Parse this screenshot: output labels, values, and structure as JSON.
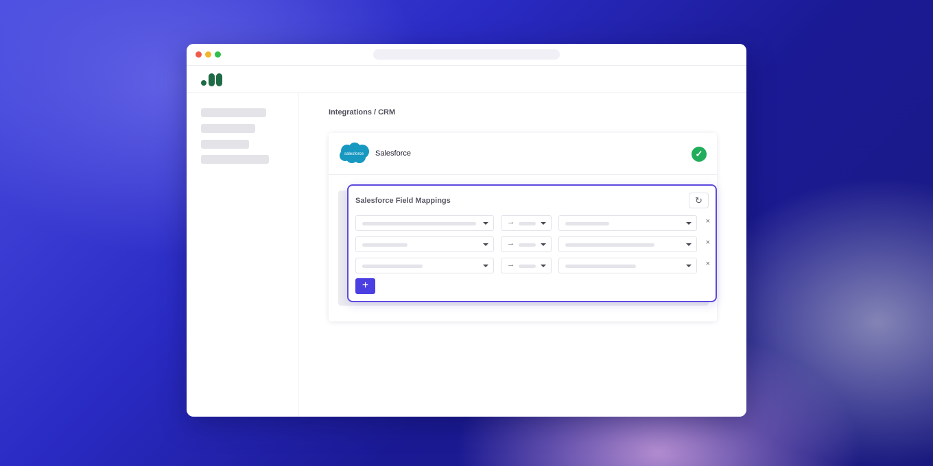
{
  "window": {
    "controls": [
      "close",
      "minimize",
      "maximize"
    ]
  },
  "app": {
    "logo_icon": "brand-bars-logo"
  },
  "main": {
    "breadcrumb": "Integrations / CRM",
    "integration": {
      "name": "Salesforce",
      "logo_text": "salesforce",
      "status_icon": "check-circle-icon",
      "status_color": "#21ad5c"
    },
    "mappings": {
      "title": "Salesforce Field Mappings",
      "refresh_icon": "refresh-icon",
      "arrow_glyph": "→",
      "remove_glyph": "×",
      "add_glyph": "+",
      "accent_color": "#4b3fe2",
      "row_count": 3
    }
  }
}
